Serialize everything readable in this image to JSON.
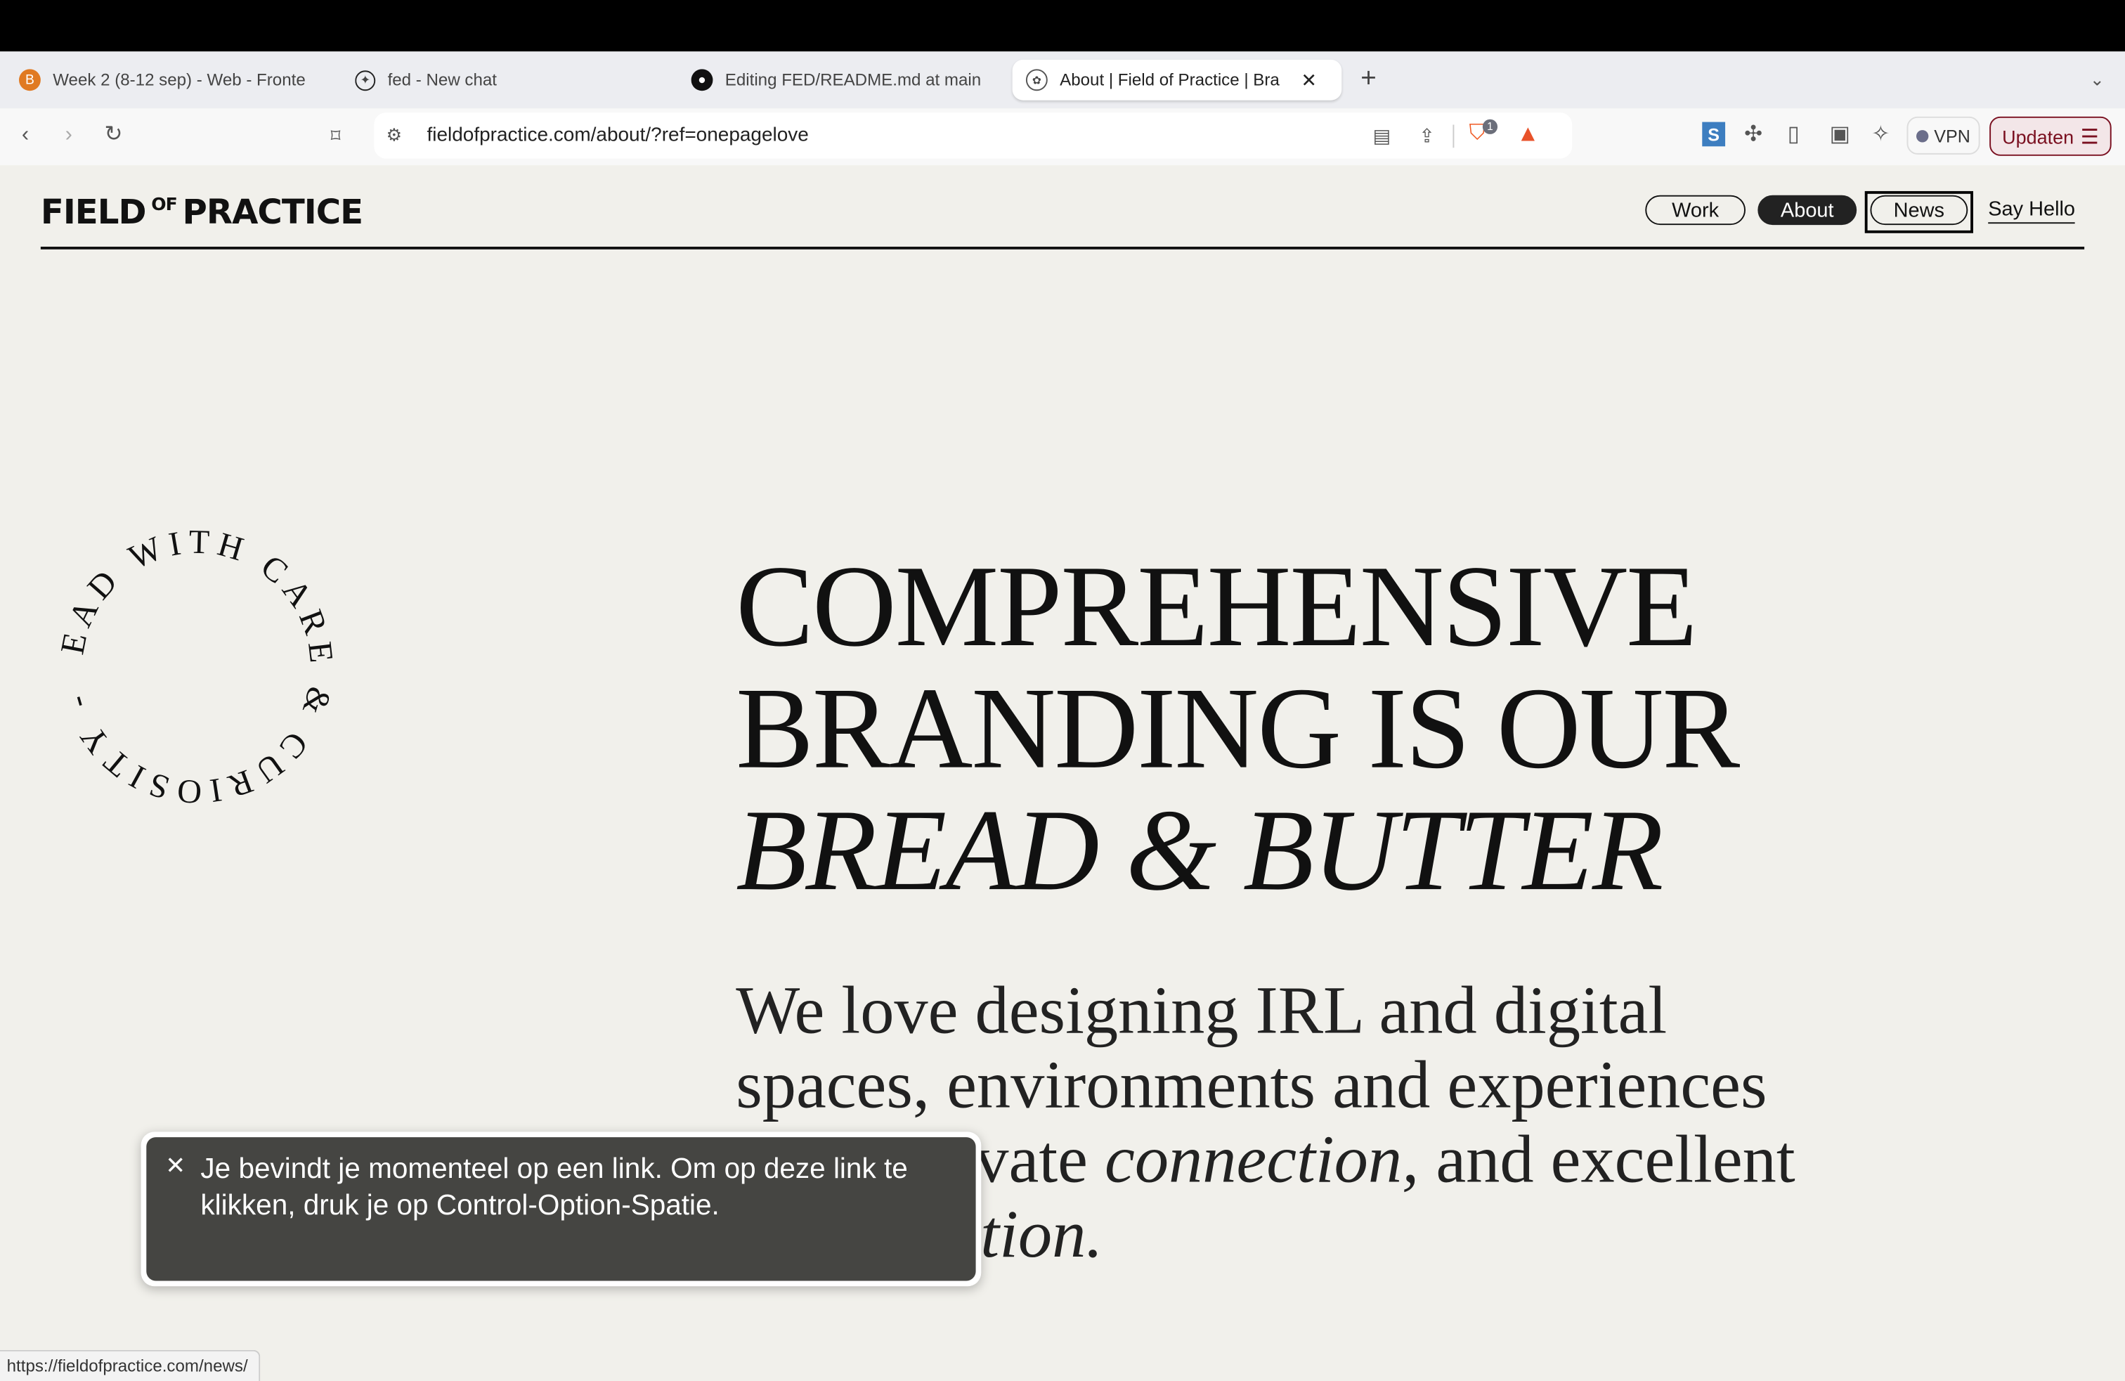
{
  "browser": {
    "tabs": [
      {
        "title": "Week 2 (8-12 sep) - Web - Fronte",
        "icon": "brightspace-icon"
      },
      {
        "title": "fed - New chat",
        "icon": "openai-icon"
      },
      {
        "title": "Editing FED/README.md at main",
        "icon": "github-icon"
      },
      {
        "title": "About | Field of Practice | Bra",
        "icon": "site-icon",
        "active": true
      }
    ],
    "url": "fieldofpractice.com/about/?ref=onepagelove",
    "shields_badge": "1",
    "vpn_label": "VPN",
    "update_label": "Updaten",
    "status_url": "https://fieldofpractice.com/news/"
  },
  "site": {
    "logo": {
      "part1": "FIELD",
      "part2": "OF",
      "part3": "PRACTICE"
    },
    "nav": [
      "Work",
      "About",
      "News",
      "Say Hello"
    ],
    "nav_active": "About",
    "badge_text": "LEAD WITH CARE & CURIOSITY - ",
    "headline": {
      "line1": "COMPREHENSIVE",
      "line2": "BRANDING IS OUR",
      "line3": "BREAD & BUTTER"
    },
    "lead": {
      "part1": "We love designing IRL and digital spaces, environments and experiences that cultivate ",
      "em1": "connection,",
      "part2": " and excellent ",
      "em2": "conversation."
    }
  },
  "toast": {
    "text": "Je bevindt je momenteel op een link. Om op deze link te klikken, druk je op Control-Option-Spatie."
  },
  "colors": {
    "page_bg": "#f1f0eb",
    "text": "#111111",
    "toast_bg": "#454542",
    "update": "#7a1020"
  }
}
